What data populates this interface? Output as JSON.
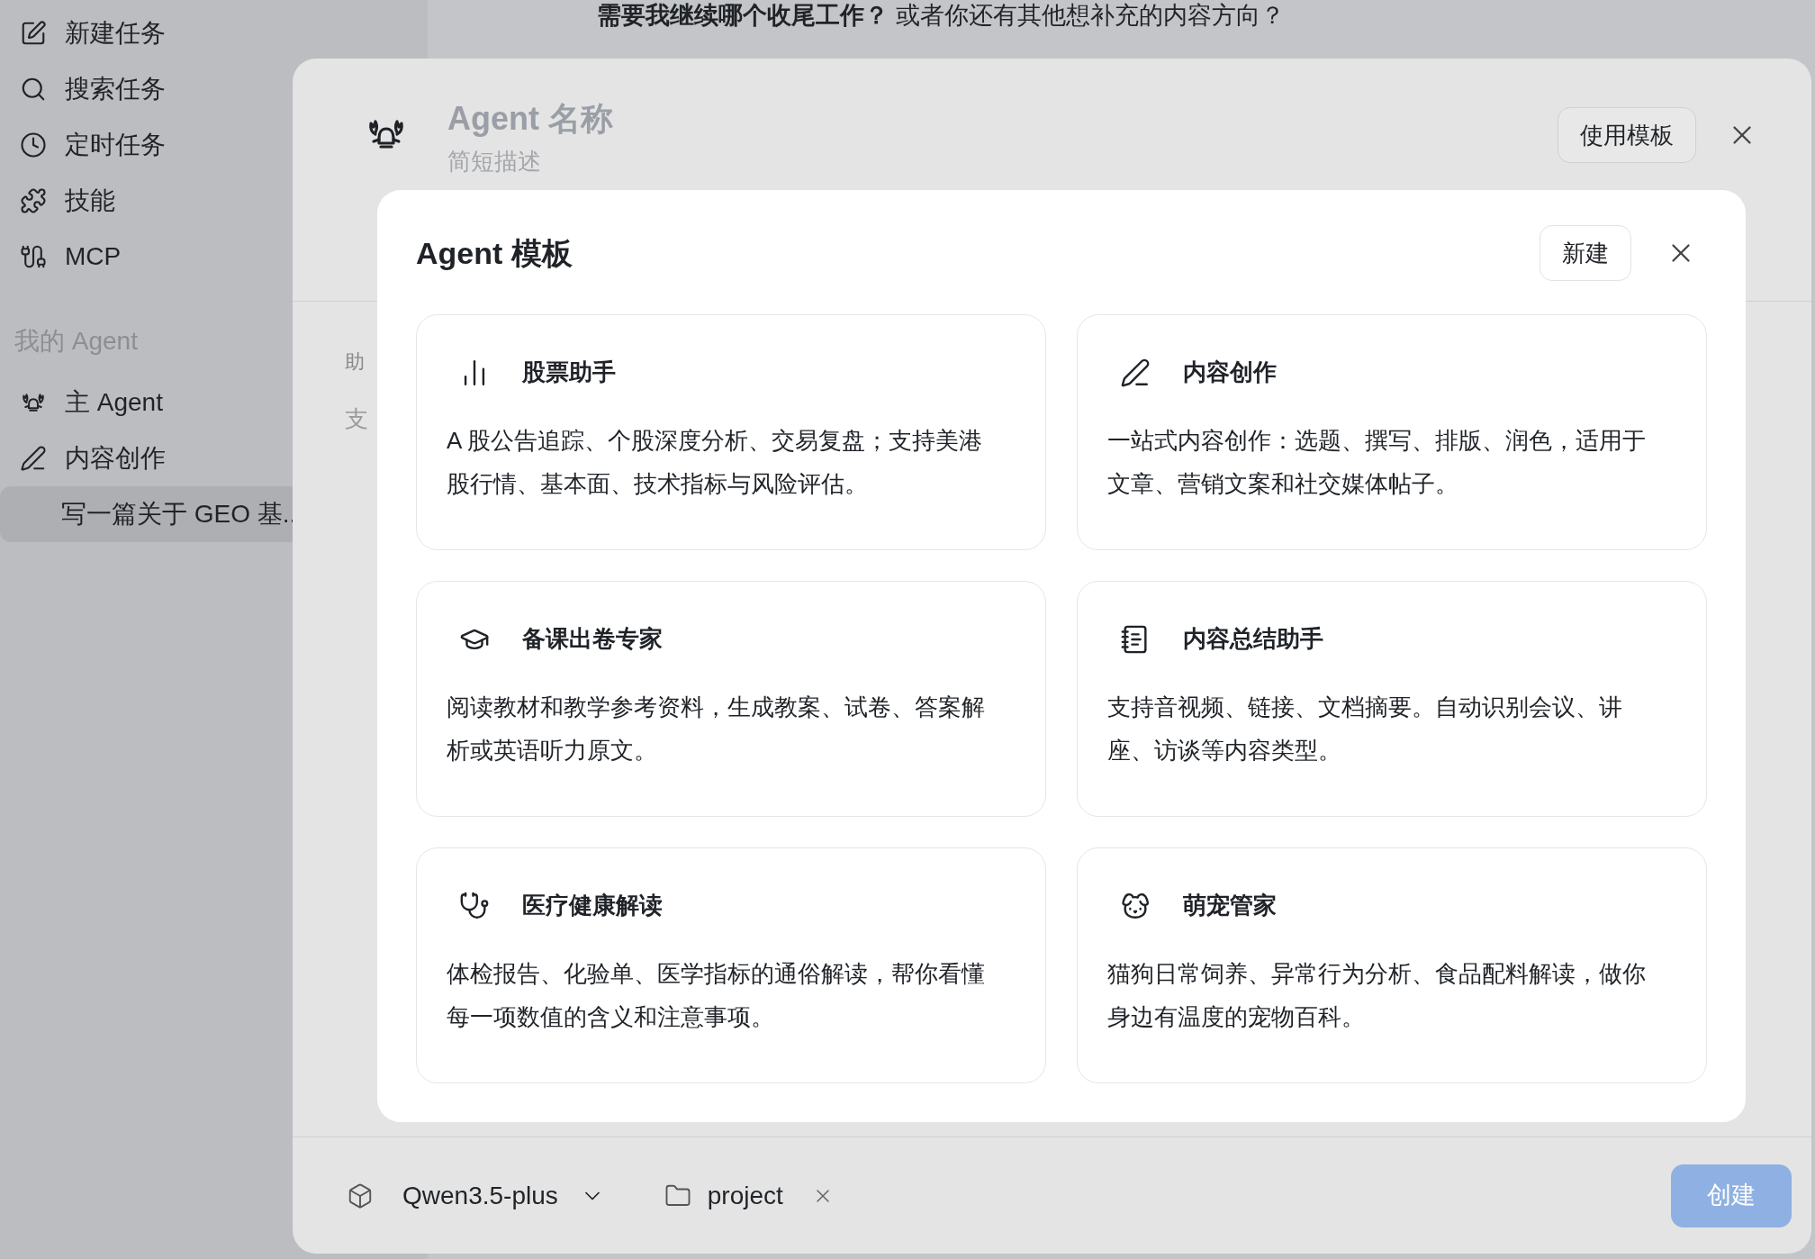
{
  "sidebar": {
    "nav_items": [
      {
        "label": "新建任务"
      },
      {
        "label": "搜索任务"
      },
      {
        "label": "定时任务"
      },
      {
        "label": "技能"
      },
      {
        "label": "MCP"
      }
    ],
    "section_title": "我的 Agent",
    "agents": [
      {
        "label": "主 Agent"
      },
      {
        "label": "内容创作",
        "children": [
          {
            "label": "写一篇关于 GEO 基..",
            "selected": true
          }
        ]
      }
    ]
  },
  "chat": {
    "message_bold": "需要我继续哪个收尾工作？",
    "message": "或者你还有其他想补充的内容方向？"
  },
  "agent_dialog": {
    "name_placeholder": "Agent 名称",
    "description_placeholder": "简短描述",
    "template_button": "使用模板",
    "field_label": "助",
    "field_text": "支",
    "model": "Qwen3.5-plus",
    "folder": "project",
    "create_button": "创建",
    "create_disabled": true
  },
  "template_modal": {
    "title": "Agent 模板",
    "new_button": "新建",
    "templates": [
      {
        "title": "股票助手",
        "description": "A 股公告追踪、个股深度分析、交易复盘；支持美港股行情、基本面、技术指标与风险评估。"
      },
      {
        "title": "内容创作",
        "description": "一站式内容创作：选题、撰写、排版、润色，适用于文章、营销文案和社交媒体帖子。"
      },
      {
        "title": "备课出卷专家",
        "description": "阅读教材和教学参考资料，生成教案、试卷、答案解析或英语听力原文。"
      },
      {
        "title": "内容总结助手",
        "description": "支持音视频、链接、文档摘要。自动识别会议、讲座、访谈等内容类型。"
      },
      {
        "title": "医疗健康解读",
        "description": "体检报告、化验单、医学指标的通俗解读，帮你看懂每一项数值的含义和注意事项。"
      },
      {
        "title": "萌宠管家",
        "description": "猫狗日常饲养、异常行为分析、食品配料解读，做你身边有温度的宠物百科。"
      }
    ]
  }
}
